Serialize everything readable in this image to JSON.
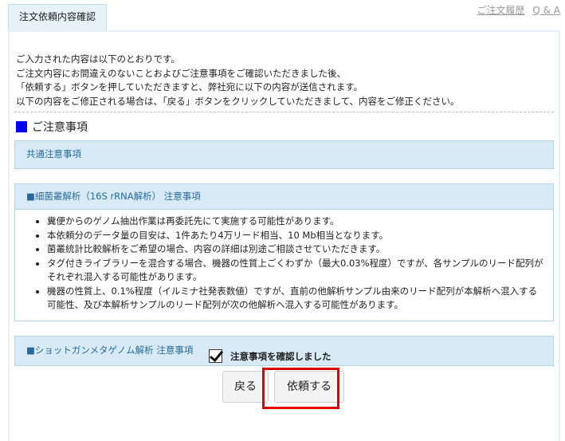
{
  "header": {
    "tab_title": "注文依頼内容確認",
    "links": [
      "ご注文履歴",
      "Q & A"
    ]
  },
  "intro": {
    "lines": [
      "ご入力された内容は以下のとおりです。",
      "ご注文内容にお間違えのないことおよびご注意事項をご確認いただきました後、",
      "「依頼する」ボタンを押していただきますと、弊社宛に以下の内容が送信されます。",
      "以下の内容をご修正される場合は、「戻る」ボタンをクリックしていただきまして、内容をご修正ください。"
    ]
  },
  "notes_section": {
    "title": "ご注意事項",
    "common_title": "共通注意事項",
    "microbiome": {
      "title": "■細菌叢解析（16S rRNA解析） 注意事項",
      "items": [
        "糞便からのゲノム抽出作業は再委託先にて実施する可能性があります。",
        "本依頼分のデータ量の目安は、1件あたり4万リード相当、10 Mb相当となります。",
        "菌叢統計比較解析をご希望の場合、内容の詳細は別途ご相談させていただきます。",
        "タグ付きライブラリーを混合する場合、機器の性質上ごくわずか（最大0.03%程度）ですが、各サンプルのリード配列がそれぞれ混入する可能性があります。",
        "機器の性質上、0.1%程度（イルミナ社発表数値）ですが、直前の他解析サンプル由来のリード配列が本解析へ混入する可能性、及び本解析サンプルのリード配列が次の他解析へ混入する可能性があります。"
      ]
    },
    "shotgun_title": "■ショットガンメタゲノム解析 注意事項"
  },
  "confirm": {
    "checkbox_label": "注意事項を確認しました",
    "checked": true
  },
  "buttons": {
    "back": "戻る",
    "submit": "依頼する"
  },
  "colors": {
    "highlight": "#e00000",
    "section_square": "#0000ee",
    "box_header": "#d7eaf5"
  }
}
